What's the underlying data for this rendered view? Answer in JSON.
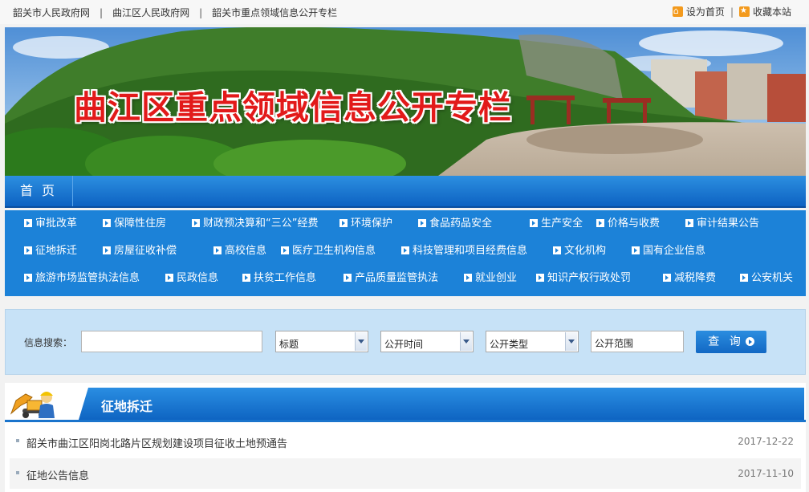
{
  "top_links": [
    "韶关市人民政府网",
    "曲江区人民政府网",
    "韶关市重点领域信息公开专栏"
  ],
  "top_separator": "|",
  "top_right": {
    "set_home": "设为首页",
    "bookmark": "收藏本站"
  },
  "banner": {
    "title": "曲江区重点领域信息公开专栏"
  },
  "nav": {
    "home": "首  页"
  },
  "categories": [
    [
      "审批改革",
      "保障性住房",
      "财政预决算和“三公”经费",
      "环境保护",
      "食品药品安全",
      "生产安全",
      "价格与收费",
      "审计结果公告"
    ],
    [
      "征地拆迁",
      "房屋征收补偿",
      "高校信息",
      "医疗卫生机构信息",
      "科技管理和项目经费信息",
      "文化机构",
      "国有企业信息"
    ],
    [
      "旅游市场监管执法信息",
      "民政信息",
      "扶贫工作信息",
      "产品质量监管执法",
      "就业创业",
      "知识产权行政处罚",
      "减税降费",
      "公安机关"
    ]
  ],
  "search": {
    "label": "信息搜索：",
    "keyword": "",
    "field": "标题",
    "time": "公开时间",
    "type": "公开类型",
    "scope": "公开范围",
    "button": "查 询"
  },
  "section": {
    "title": "征地拆迁",
    "items": [
      {
        "title": "韶关市曲江区阳岗北路片区规划建设项目征收土地预通告",
        "date": "2017-12-22"
      },
      {
        "title": "征地公告信息",
        "date": "2017-11-10"
      }
    ]
  },
  "colors": {
    "nav_blue": "#1c82d8",
    "title_red": "#e21a1a",
    "icon_orange": "#f39a1d"
  }
}
